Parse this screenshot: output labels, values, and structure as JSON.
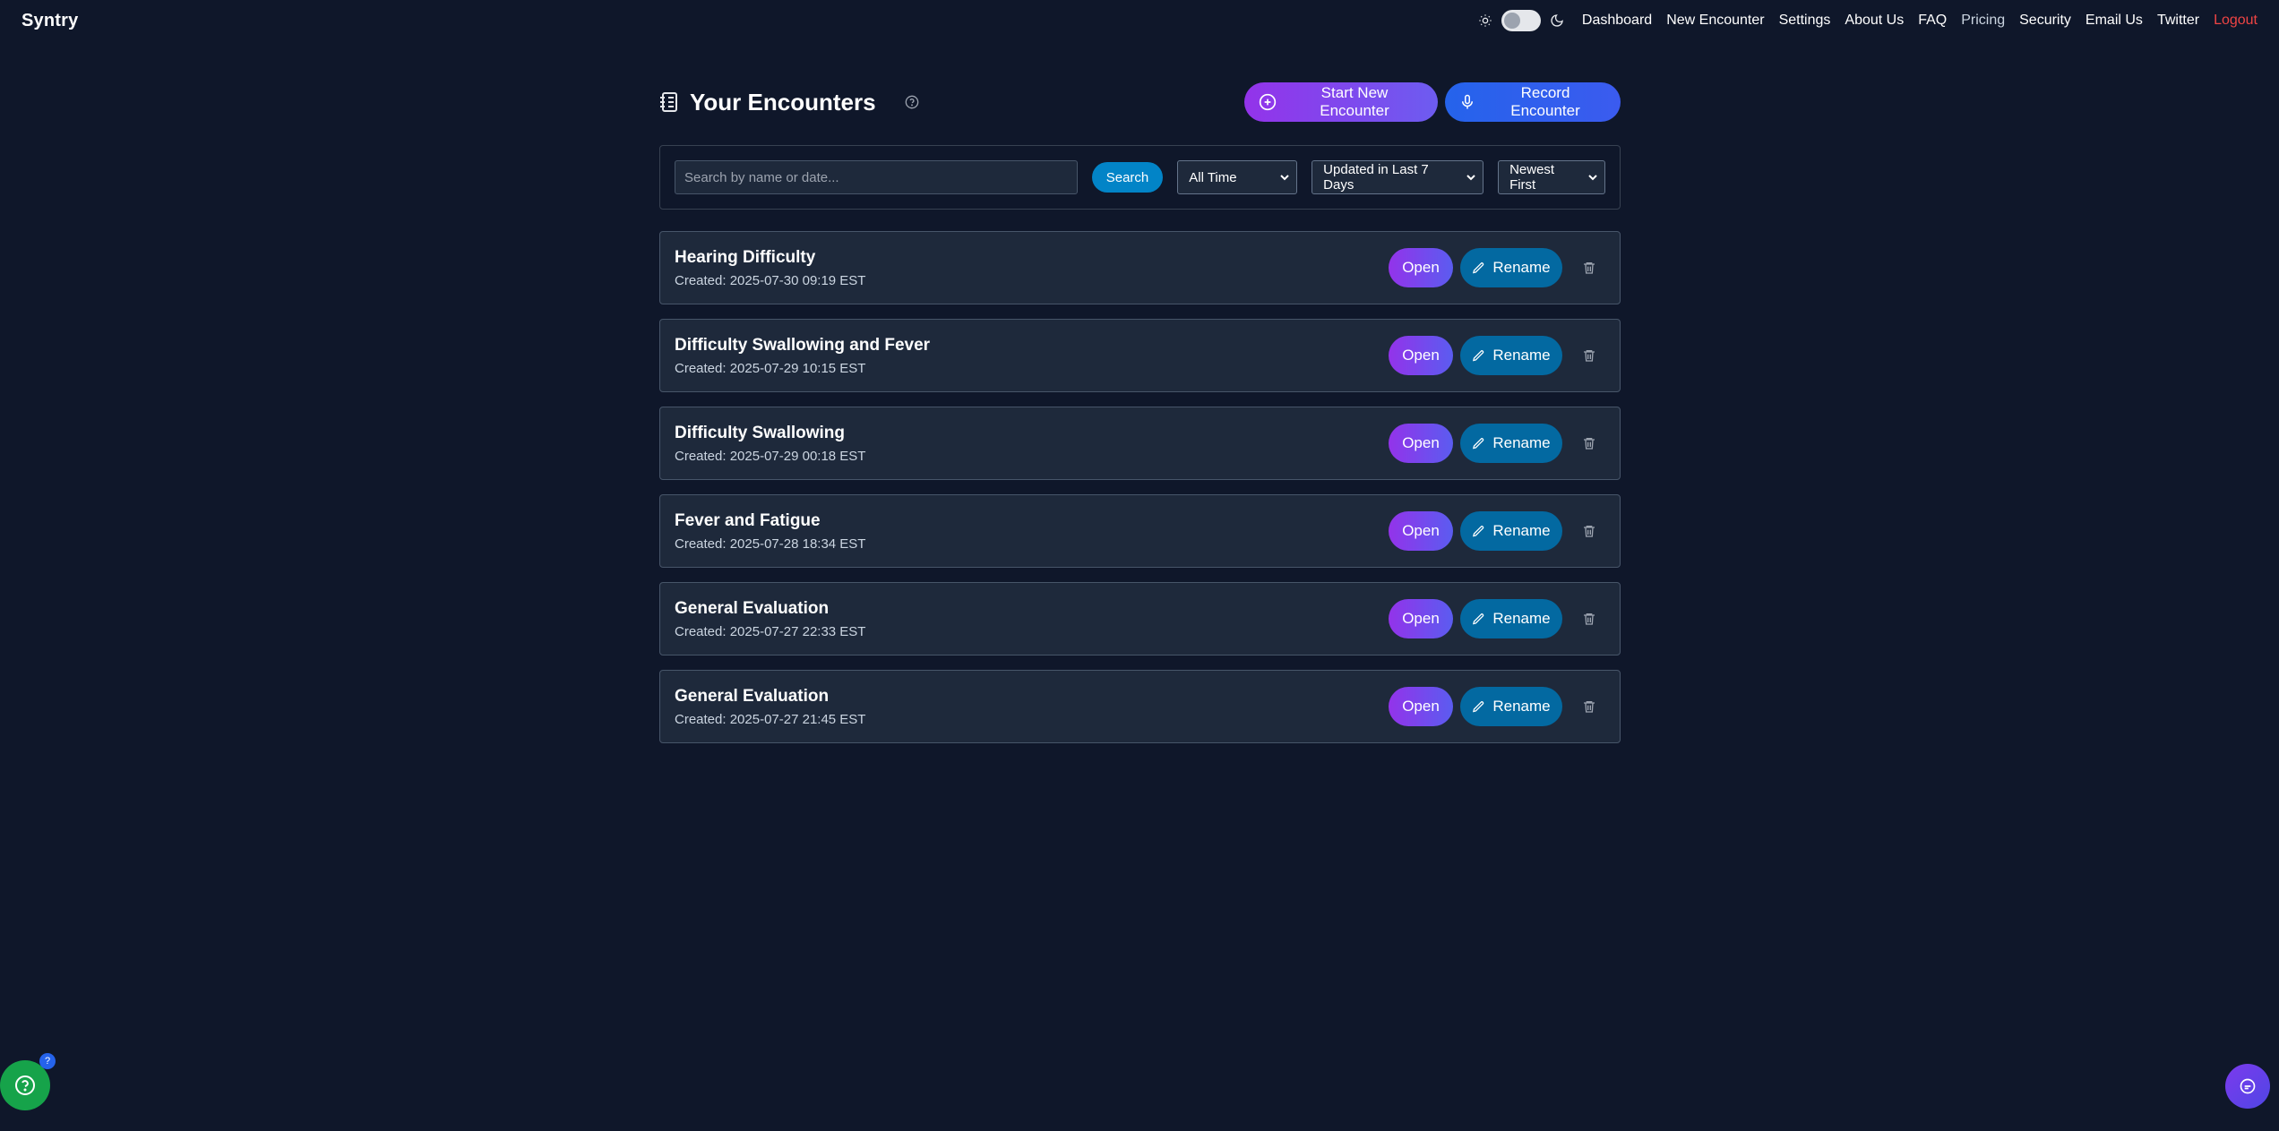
{
  "brand": "Syntry",
  "nav": {
    "links": [
      {
        "label": "Dashboard",
        "name": "nav-dashboard"
      },
      {
        "label": "New Encounter",
        "name": "nav-new-encounter"
      },
      {
        "label": "Settings",
        "name": "nav-settings"
      },
      {
        "label": "About Us",
        "name": "nav-about-us"
      },
      {
        "label": "FAQ",
        "name": "nav-faq"
      },
      {
        "label": "Pricing",
        "name": "nav-pricing"
      },
      {
        "label": "Security",
        "name": "nav-security"
      },
      {
        "label": "Email Us",
        "name": "nav-email-us"
      },
      {
        "label": "Twitter",
        "name": "nav-twitter"
      },
      {
        "label": "Logout",
        "name": "nav-logout"
      }
    ]
  },
  "page": {
    "title": "Your Encounters",
    "start_label": "Start New Encounter",
    "record_label": "Record Encounter"
  },
  "filters": {
    "search_placeholder": "Search by name or date...",
    "search_label": "Search",
    "time_range": "All Time",
    "updated": "Updated in Last 7 Days",
    "sort": "Newest First"
  },
  "encounters": [
    {
      "title": "Hearing Difficulty",
      "created": "Created: 2025-07-30 09:19 EST"
    },
    {
      "title": "Difficulty Swallowing and Fever",
      "created": "Created: 2025-07-29 10:15 EST"
    },
    {
      "title": "Difficulty Swallowing",
      "created": "Created: 2025-07-29 00:18 EST"
    },
    {
      "title": "Fever and Fatigue",
      "created": "Created: 2025-07-28 18:34 EST"
    },
    {
      "title": "General Evaluation",
      "created": "Created: 2025-07-27 22:33 EST"
    },
    {
      "title": "General Evaluation",
      "created": "Created: 2025-07-27 21:45 EST"
    }
  ],
  "card_actions": {
    "open_label": "Open",
    "rename_label": "Rename"
  },
  "help_badge": "?",
  "colors": {
    "background": "#0f172a",
    "card": "#1e293b",
    "accent_purple": "#9333ea",
    "accent_blue": "#2563eb",
    "rename_blue": "#0369a1",
    "logout_red": "#ef4444",
    "help_green": "#16a34a"
  },
  "icons": [
    "sun-icon",
    "moon-icon",
    "notebook-icon",
    "help-circle-icon",
    "plus-circle-icon",
    "microphone-icon",
    "chevron-down-icon",
    "pencil-icon",
    "trash-icon",
    "chat-icon"
  ]
}
